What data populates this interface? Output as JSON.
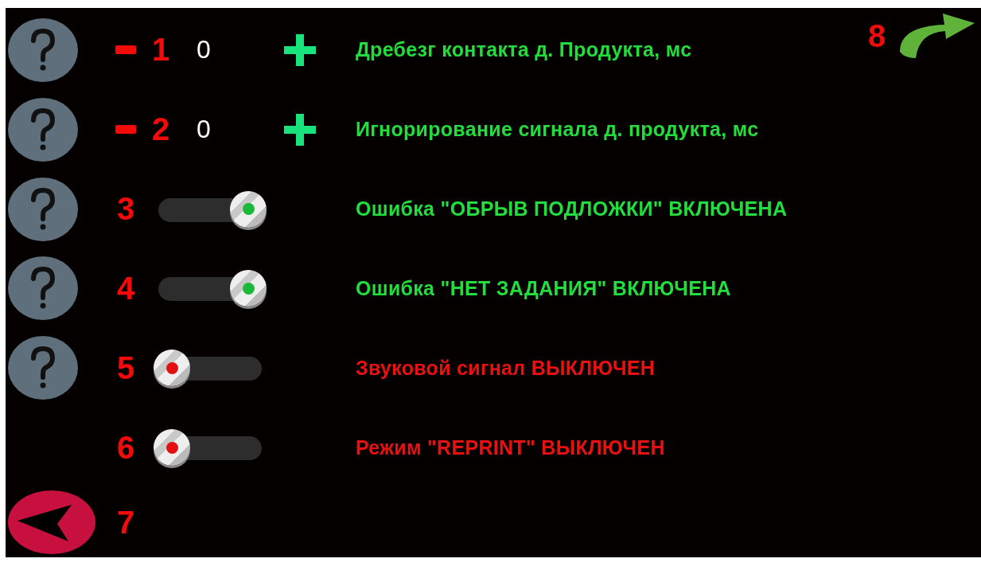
{
  "rows": [
    {
      "kind": "stepper",
      "help": true,
      "number": "1",
      "value": "0",
      "label": "Дребезг контакта д. Продукта, мс"
    },
    {
      "kind": "stepper",
      "help": true,
      "number": "2",
      "value": "0",
      "label": "Игнорирование сигнала д. продукта, мс"
    },
    {
      "kind": "toggle",
      "help": true,
      "number": "3",
      "on": true,
      "label": "Ошибка \"ОБРЫВ ПОДЛОЖКИ\" ВКЛЮЧЕНА"
    },
    {
      "kind": "toggle",
      "help": true,
      "number": "4",
      "on": true,
      "label": "Ошибка \"НЕТ ЗАДАНИЯ\" ВКЛЮЧЕНА"
    },
    {
      "kind": "toggle",
      "help": true,
      "number": "5",
      "on": false,
      "label": "Звуковой сигнал ВЫКЛЮЧЕН"
    },
    {
      "kind": "toggle",
      "help": false,
      "number": "6",
      "on": false,
      "label": "Режим \"REPRINT\" ВЫКЛЮЧЕН"
    }
  ],
  "back": {
    "number": "7"
  },
  "forward": {
    "number": "8"
  }
}
